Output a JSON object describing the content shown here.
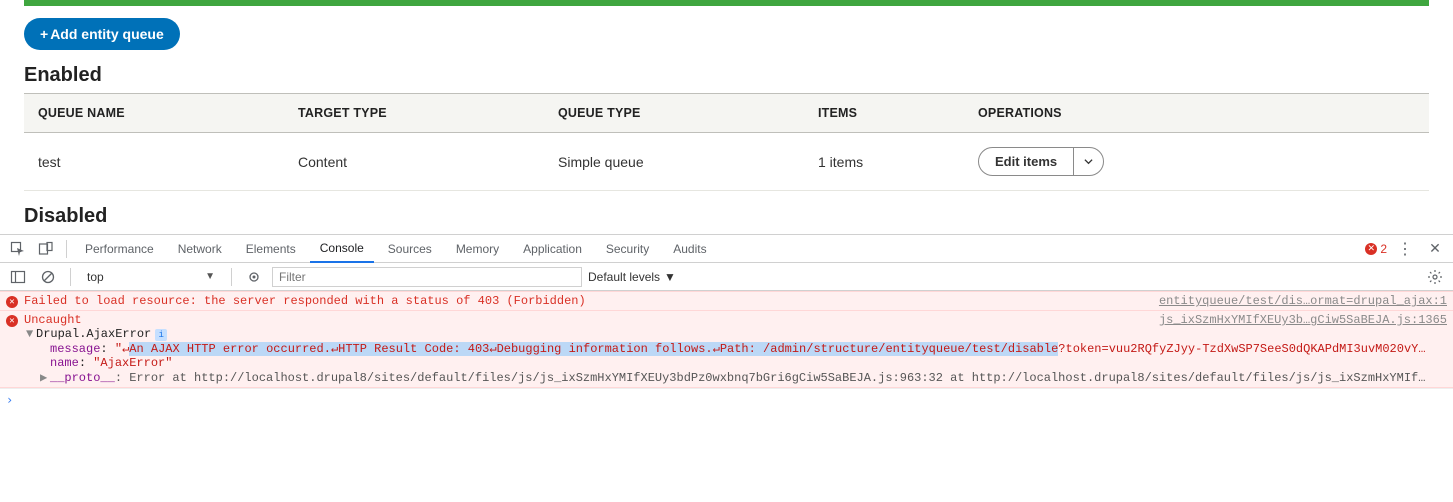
{
  "addButton": "Add entity queue",
  "enabledHeading": "Enabled",
  "disabledHeading": "Disabled",
  "cols": {
    "name": "QUEUE NAME",
    "target": "TARGET TYPE",
    "qtype": "QUEUE TYPE",
    "items": "ITEMS",
    "ops": "OPERATIONS"
  },
  "rows": [
    {
      "name": "test",
      "target": "Content",
      "qtype": "Simple queue",
      "items": "1 items",
      "op": "Edit items"
    }
  ],
  "dev": {
    "tabs": [
      "Performance",
      "Network",
      "Elements",
      "Console",
      "Sources",
      "Memory",
      "Application",
      "Security",
      "Audits"
    ],
    "activeTab": "Console",
    "errCount": "2",
    "context": "top",
    "filterPlaceholder": "Filter",
    "levels": "Default levels",
    "log": {
      "l1": {
        "msg": "Failed to load resource: the server responded with a status of 403 (Forbidden)",
        "src": "entityqueue/test/dis…ormat=drupal_ajax:1"
      },
      "l2": {
        "msg": "Uncaught",
        "src": "js_ixSzmHxYMIfXEUy3b…gCiw5SaBEJA.js:1365"
      },
      "obj": {
        "head": "Drupal.AjaxError",
        "msgKey": "message",
        "msgPre": "\"↵",
        "msgHl": "An AJAX HTTP error occurred.↵HTTP Result Code: 403↵Debugging information follows.↵Path: /admin/structure/entityqueue/test/disable",
        "msgTail": "?token=vuu2RQfyZJyy-TzdXwSP7SeeS0dQKAPdMI3uvM020vY…",
        "nameKey": "name",
        "nameVal": "\"AjaxError\"",
        "protoKey": "__proto__",
        "protoVal": ": Error at http://localhost.drupal8/sites/default/files/js/js_ixSzmHxYMIfXEUy3bdPz0wxbnq7bGri6gCiw5SaBEJA.js:963:32 at http://localhost.drupal8/sites/default/files/js/js_ixSzmHxYMIf…"
      }
    }
  }
}
